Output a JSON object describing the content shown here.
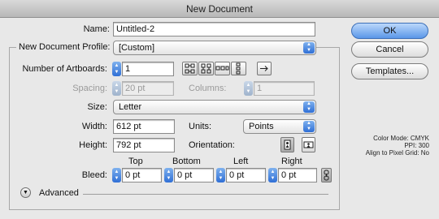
{
  "window": {
    "title": "New Document"
  },
  "name": {
    "label": "Name:",
    "value": "Untitled-2"
  },
  "profile": {
    "label": "New Document Profile:",
    "value": "[Custom]"
  },
  "artboards": {
    "label": "Number of Artboards:",
    "value": "1"
  },
  "spacing": {
    "label": "Spacing:",
    "value": "20 pt"
  },
  "columns": {
    "label": "Columns:",
    "value": "1"
  },
  "size": {
    "label": "Size:",
    "value": "Letter"
  },
  "width": {
    "label": "Width:",
    "value": "612 pt"
  },
  "units": {
    "label": "Units:",
    "value": "Points"
  },
  "height": {
    "label": "Height:",
    "value": "792 pt"
  },
  "orientation": {
    "label": "Orientation:"
  },
  "bleed": {
    "label": "Bleed:",
    "top": {
      "label": "Top",
      "value": "0 pt"
    },
    "bottom": {
      "label": "Bottom",
      "value": "0 pt"
    },
    "left": {
      "label": "Left",
      "value": "0 pt"
    },
    "right": {
      "label": "Right",
      "value": "0 pt"
    }
  },
  "advanced": {
    "label": "Advanced"
  },
  "buttons": {
    "ok": "OK",
    "cancel": "Cancel",
    "templates": "Templates..."
  },
  "info": {
    "color_mode": "Color Mode: CMYK",
    "ppi": "PPI: 300",
    "align": "Align to Pixel Grid: No"
  },
  "colors": {
    "accent": "#3d7fe0",
    "default_button": "#6ea4ec"
  },
  "icons": [
    "grid-by-row-icon",
    "grid-by-column-icon",
    "arrange-by-row-icon",
    "arrange-by-column-icon",
    "right-to-left-icon",
    "portrait-icon",
    "landscape-icon",
    "link-bleed-icon"
  ]
}
